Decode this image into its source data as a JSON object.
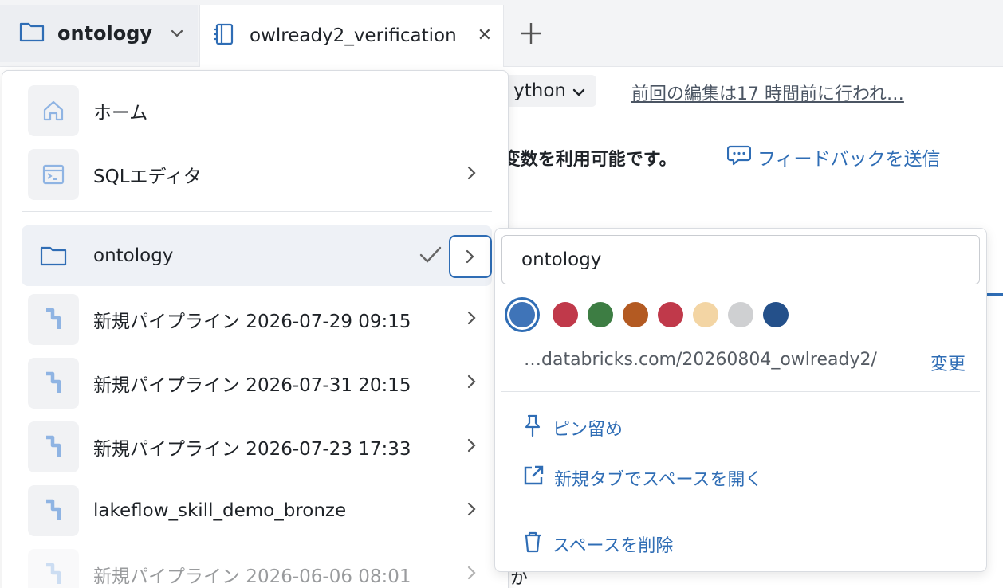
{
  "tabs": {
    "workspace_label": "ontology",
    "notebook_label": "owlready2_verification"
  },
  "background": {
    "language": "ython",
    "last_edited": "前回の編集は17 時間前に行われ…",
    "info_text": "on変数を利用可能です。",
    "feedback_link": "フィードバックを送信",
    "partial_char": "か"
  },
  "dropdown": {
    "items": [
      {
        "label": "ホーム",
        "icon": "home-icon"
      },
      {
        "label": "SQLエディタ",
        "icon": "sql-editor-icon"
      },
      {
        "label": "ontology",
        "icon": "folder-icon",
        "selected": true
      },
      {
        "label": "新規パイプライン 2026-07-29 09:15",
        "icon": "pipeline-icon"
      },
      {
        "label": "新規パイプライン 2026-07-31 20:15",
        "icon": "pipeline-icon"
      },
      {
        "label": "新規パイプライン 2026-07-23 17:33",
        "icon": "pipeline-icon"
      },
      {
        "label": "lakeflow_skill_demo_bronze",
        "icon": "pipeline-icon"
      },
      {
        "label": "新規パイプライン 2026-06-06 08:01",
        "icon": "pipeline-icon"
      }
    ]
  },
  "submenu": {
    "space_name": "ontology",
    "colors": [
      "#3f74b8",
      "#c0394a",
      "#3d7d43",
      "#b35a22",
      "#c0394a",
      "#f3d5a4",
      "#cfd0d2",
      "#24508a"
    ],
    "selected_color": "#3f74b8",
    "path": "…databricks.com/20260804_owlready2/",
    "change_label": "変更",
    "pin_label": "ピン留め",
    "open_new_tab_label": "新規タブでスペースを開く",
    "delete_label": "スペースを削除"
  },
  "colors": {
    "accent": "#2f6db5",
    "icon_blue": "#8fb4e3"
  }
}
